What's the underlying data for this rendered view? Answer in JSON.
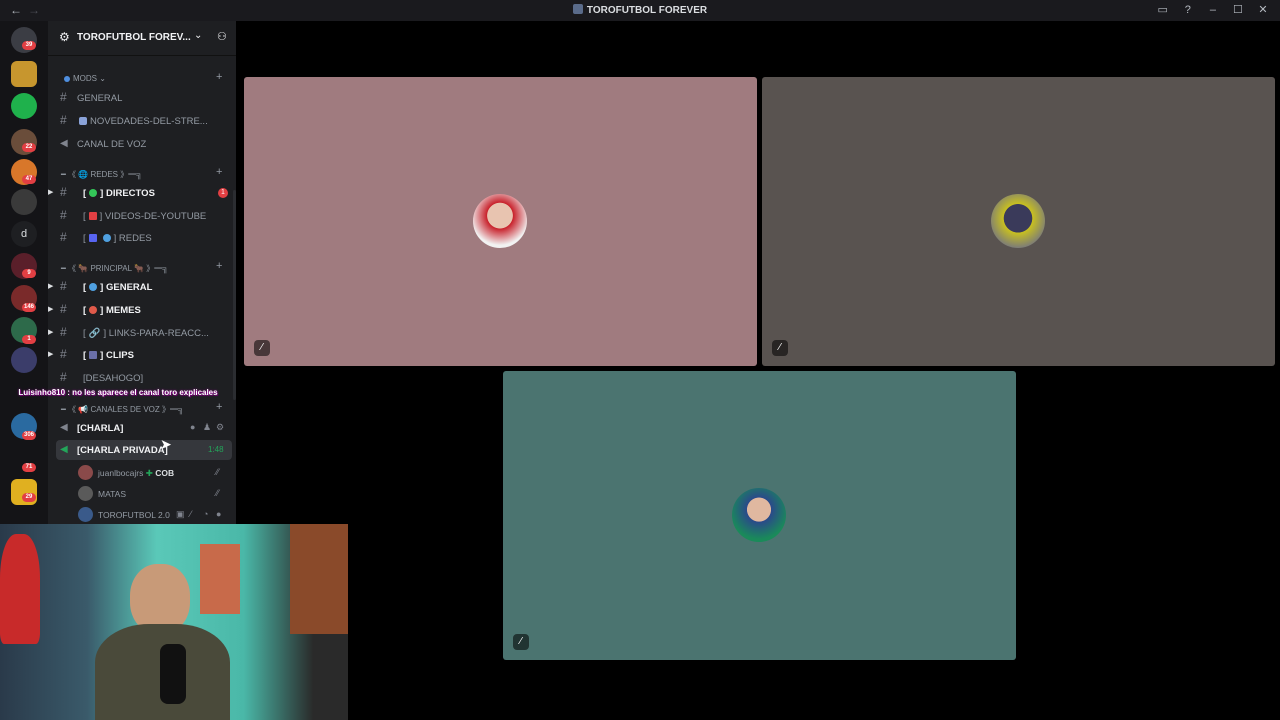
{
  "window": {
    "title": "TOROFUTBOL FOREVER",
    "back_icon": "arrow-left-icon",
    "forward_icon": "arrow-right-icon",
    "controls": [
      "inbox-icon",
      "help-icon",
      "minimize-icon",
      "maximize-icon",
      "close-icon"
    ]
  },
  "server_rail": {
    "badges": [
      "39",
      "22",
      "47",
      "9",
      "146",
      "1",
      "306",
      "71",
      "29"
    ],
    "dm_letter": "d"
  },
  "server": {
    "name": "TOROFUTBOL FOREV...",
    "categories": {
      "mods": "MODS",
      "redes": "━ 《 🌐 REDES 》━╗",
      "principal": "━ 《 🐂 PRINCIPAL 🐂 》━╗",
      "voz": "━ 《 📢 CANALES DE VOZ 》━╗"
    },
    "channels": {
      "general_mod": "GENERAL",
      "novedades": "NOVEDADES-DEL-STRE...",
      "canal_voz": "CANAL DE VOZ",
      "directos": "DIRECTOS",
      "directos_unread": "1",
      "videos": "VIDEOS-DE-YOUTUBE",
      "redes": "REDES",
      "general": "GENERAL",
      "memes": "MEMES",
      "links": "LINKS-PARA-REACC...",
      "clips": "CLIPS",
      "desahogo": "DESAHOGO",
      "charla": "[CHARLA]",
      "charla_privada": "[CHARLA PRIVADA]",
      "charla_privada_time": "1:48"
    },
    "voice_users": [
      {
        "name": "juanlbocajrs",
        "tag": "COB"
      },
      {
        "name": "MATAS"
      },
      {
        "name": "TOROFUTBOL 2.0"
      }
    ]
  },
  "stream_overlay": {
    "chat_message": "Luisinho810 : no les aparece el canal toro explicales"
  },
  "tiles": {
    "tile1_color": "#a07b7f",
    "tile2_color": "#595350",
    "tile3_color": "#4b7470"
  },
  "colors": {
    "sidebar": "#1e1f22",
    "rail": "#141417",
    "unread": "#e23f43",
    "voice_active": "#23a55a"
  }
}
